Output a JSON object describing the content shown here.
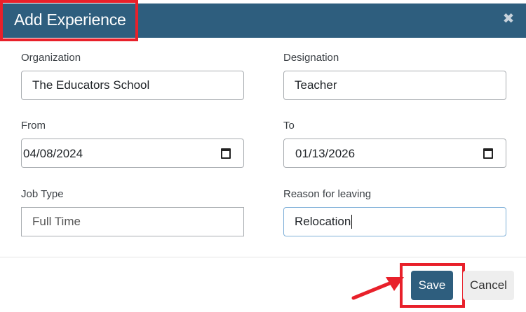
{
  "modal": {
    "title": "Add Experience",
    "close_icon": "close-icon"
  },
  "form": {
    "organization": {
      "label": "Organization",
      "value": "The Educators School"
    },
    "designation": {
      "label": "Designation",
      "value": "Teacher"
    },
    "from": {
      "label": "From",
      "value": "04/08/2024",
      "icon": "calendar-icon"
    },
    "to": {
      "label": "To",
      "value": "01/13/2026",
      "icon": "calendar-icon"
    },
    "job_type": {
      "label": "Job Type",
      "placeholder": "Full Time"
    },
    "reason": {
      "label": "Reason for leaving",
      "value": "Relocation"
    }
  },
  "footer": {
    "save_label": "Save",
    "cancel_label": "Cancel"
  },
  "colors": {
    "header_bg": "#2e5e7e",
    "highlight": "#e8202a",
    "primary_button": "#2e5e7e"
  }
}
